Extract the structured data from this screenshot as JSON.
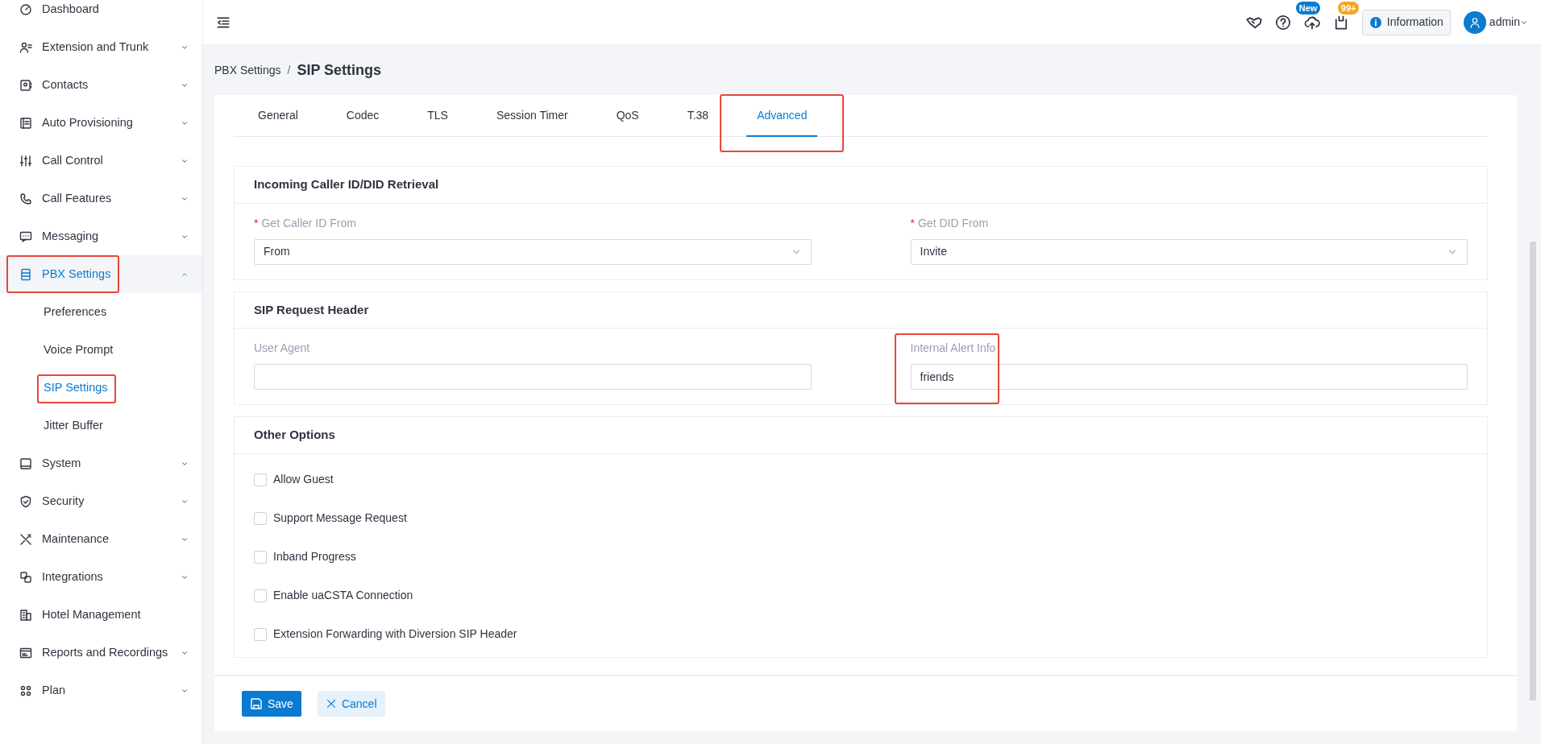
{
  "sidebar": {
    "items": [
      {
        "label": "Dashboard",
        "kind": "link",
        "expanded": false,
        "selected": false,
        "highlighted": false
      },
      {
        "label": "Extension and Trunk",
        "kind": "group",
        "expanded": false,
        "selected": false,
        "highlighted": false
      },
      {
        "label": "Contacts",
        "kind": "group",
        "expanded": false,
        "selected": false,
        "highlighted": false
      },
      {
        "label": "Auto Provisioning",
        "kind": "group",
        "expanded": false,
        "selected": false,
        "highlighted": false
      },
      {
        "label": "Call Control",
        "kind": "group",
        "expanded": false,
        "selected": false,
        "highlighted": false
      },
      {
        "label": "Call Features",
        "kind": "group",
        "expanded": false,
        "selected": false,
        "highlighted": false
      },
      {
        "label": "Messaging",
        "kind": "group",
        "expanded": false,
        "selected": false,
        "highlighted": false
      },
      {
        "label": "PBX Settings",
        "kind": "group",
        "expanded": true,
        "selected": true,
        "highlighted": true,
        "children": [
          {
            "label": "Preferences",
            "selected": false,
            "highlighted": false
          },
          {
            "label": "Voice Prompt",
            "selected": false,
            "highlighted": false
          },
          {
            "label": "SIP Settings",
            "selected": true,
            "highlighted": true
          },
          {
            "label": "Jitter Buffer",
            "selected": false,
            "highlighted": false
          }
        ]
      },
      {
        "label": "System",
        "kind": "group",
        "expanded": false,
        "selected": false,
        "highlighted": false
      },
      {
        "label": "Security",
        "kind": "group",
        "expanded": false,
        "selected": false,
        "highlighted": false
      },
      {
        "label": "Maintenance",
        "kind": "group",
        "expanded": false,
        "selected": false,
        "highlighted": false
      },
      {
        "label": "Integrations",
        "kind": "group",
        "expanded": false,
        "selected": false,
        "highlighted": false
      },
      {
        "label": "Hotel Management",
        "kind": "link",
        "expanded": false,
        "selected": false,
        "highlighted": false
      },
      {
        "label": "Reports and Recordings",
        "kind": "group",
        "expanded": false,
        "selected": false,
        "highlighted": false
      },
      {
        "label": "Plan",
        "kind": "group",
        "expanded": false,
        "selected": false,
        "highlighted": false
      }
    ]
  },
  "topbar": {
    "badges": [
      "New",
      "99+"
    ],
    "info_button": "Information",
    "user": "admin"
  },
  "breadcrumb": {
    "parent": "PBX Settings",
    "separator": "/",
    "current": "SIP Settings"
  },
  "tabs": [
    {
      "label": "General",
      "selected": false,
      "highlighted": false
    },
    {
      "label": "Codec",
      "selected": false,
      "highlighted": false
    },
    {
      "label": "TLS",
      "selected": false,
      "highlighted": false
    },
    {
      "label": "Session Timer",
      "selected": false,
      "highlighted": false
    },
    {
      "label": "QoS",
      "selected": false,
      "highlighted": false
    },
    {
      "label": "T.38",
      "selected": false,
      "highlighted": false
    },
    {
      "label": "Advanced",
      "selected": true,
      "highlighted": true
    }
  ],
  "sections": [
    {
      "title": "Incoming Caller ID/DID Retrieval",
      "fields": [
        {
          "kind": "select",
          "required_mark": "*",
          "label": "Get Caller ID From",
          "value": "From",
          "highlighted": false
        },
        {
          "kind": "select",
          "required_mark": "*",
          "label": "Get DID From",
          "value": "Invite",
          "highlighted": false
        }
      ]
    },
    {
      "title": "SIP Request Header",
      "fields": [
        {
          "kind": "text",
          "label": "User Agent",
          "highlighted": false
        },
        {
          "kind": "text",
          "label": "Internal Alert Info",
          "value": "friends",
          "highlighted": true
        }
      ]
    },
    {
      "title": "Other Options",
      "fields": [
        {
          "kind": "checkbox",
          "label": "Allow Guest",
          "checked": false
        },
        {
          "kind": "checkbox",
          "label": "Support Message Request",
          "checked": false
        },
        {
          "kind": "checkbox",
          "label": "Inband Progress",
          "checked": false
        },
        {
          "kind": "checkbox",
          "label": "Enable uaCSTA Connection",
          "checked": false
        },
        {
          "kind": "checkbox",
          "label": "Extension Forwarding with Diversion SIP Header",
          "checked": false
        }
      ]
    }
  ],
  "footer": {
    "save": "Save",
    "cancel": "Cancel"
  }
}
